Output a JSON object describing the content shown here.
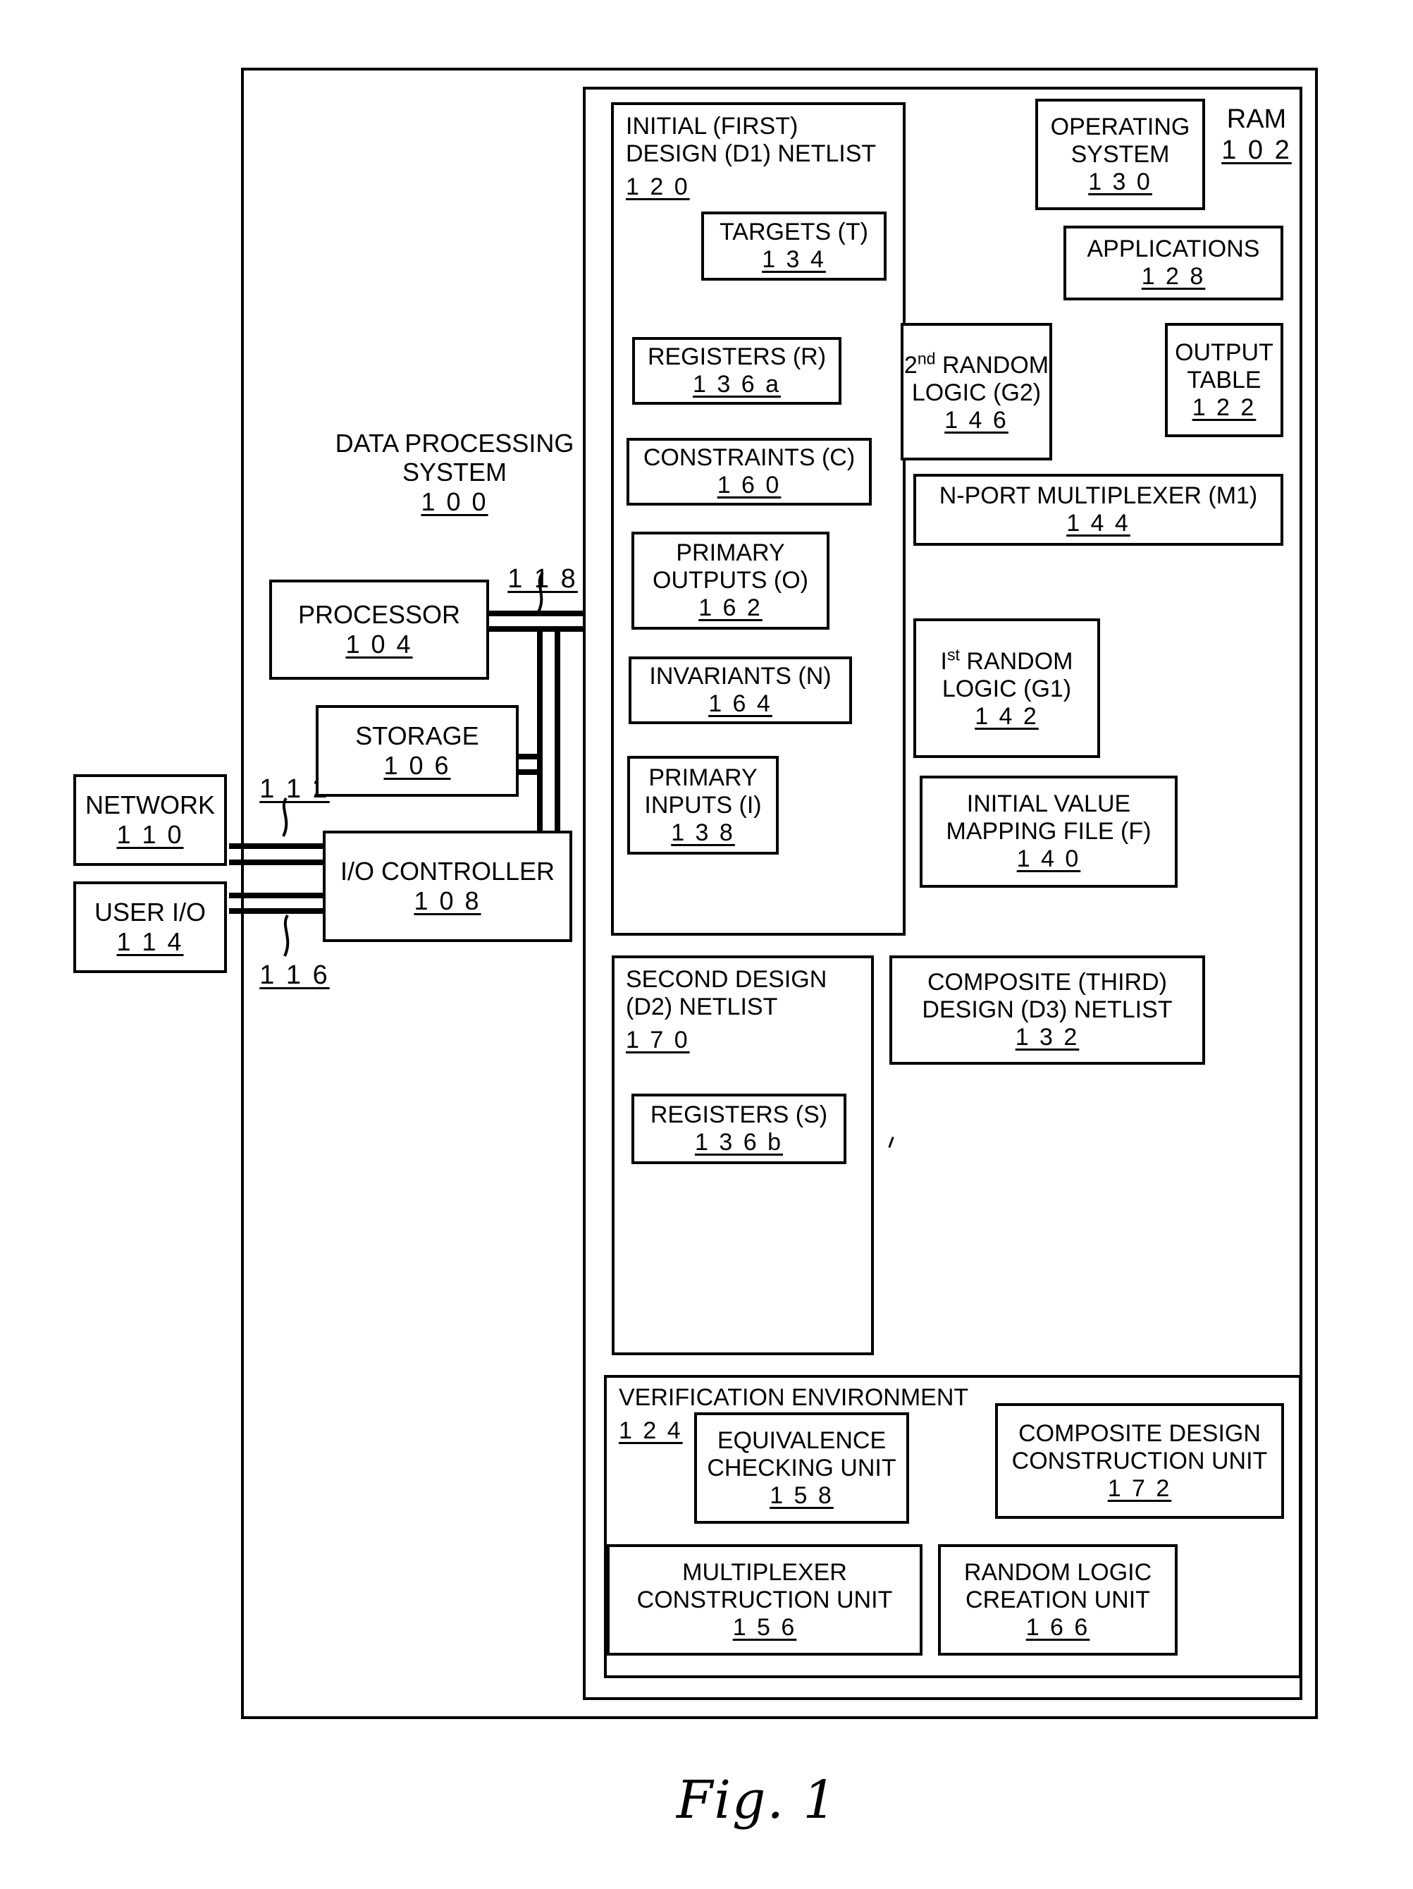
{
  "figure": {
    "caption": "Fig.  1"
  },
  "system": {
    "title_line1": "DATA PROCESSING",
    "title_line2": "SYSTEM",
    "ref": "1 0 0"
  },
  "bus": {
    "ref_118": "1 1 8",
    "ref_112": "1 1 2",
    "ref_116": "1 1 6"
  },
  "hardware": [
    {
      "name": "processor",
      "label": "PROCESSOR",
      "ref": "1 0 4"
    },
    {
      "name": "storage",
      "label": "STORAGE",
      "ref": "1 0 6"
    },
    {
      "name": "io-controller",
      "label": "I/O CONTROLLER",
      "ref": "1 0 8"
    },
    {
      "name": "network",
      "label": "NETWORK",
      "ref": "1 1 0"
    },
    {
      "name": "user-io",
      "label": "USER I/O",
      "ref": "1 1 4"
    }
  ],
  "ram": {
    "label": "RAM",
    "ref": "1 0 2"
  },
  "d1": {
    "label_line1": "INITIAL (FIRST)",
    "label_line2": "DESIGN (D1) NETLIST",
    "ref": "1 2 0",
    "children": [
      {
        "name": "targets",
        "line1": "TARGETS (T)",
        "line2": "",
        "ref": "1 3 4"
      },
      {
        "name": "registers-r",
        "line1": "REGISTERS (R)",
        "line2": "",
        "ref": "1 3 6 a"
      },
      {
        "name": "constraints",
        "line1": "CONSTRAINTS (C)",
        "line2": "",
        "ref": "1 6 0"
      },
      {
        "name": "primary-outputs",
        "line1": "PRIMARY",
        "line2": "OUTPUTS (O)",
        "ref": "1 6 2"
      },
      {
        "name": "invariants",
        "line1": "INVARIANTS (N)",
        "line2": "",
        "ref": "1 6 4"
      },
      {
        "name": "primary-inputs",
        "line1": "PRIMARY",
        "line2": "INPUTS (I)",
        "ref": "1 3 8"
      }
    ]
  },
  "ram_items": [
    {
      "name": "operating-system",
      "line1": "OPERATING",
      "line2": "SYSTEM",
      "ref": "1 3 0"
    },
    {
      "name": "applications",
      "line1": "APPLICATIONS",
      "line2": "",
      "ref": "1 2 8"
    },
    {
      "name": "second-random-logic",
      "line1": "2<sup>nd</sup> RANDOM",
      "line2": "LOGIC (G2)",
      "ref": "1 4 6"
    },
    {
      "name": "output-table",
      "line1": "OUTPUT",
      "line2": "TABLE",
      "ref": "1 2 2"
    },
    {
      "name": "n-port-multiplexer",
      "line1": "N-PORT MULTIPLEXER (M1)",
      "line2": "",
      "ref": "1 4 4"
    },
    {
      "name": "first-random-logic",
      "line1": "I<sup>st</sup>  RANDOM",
      "line2": "LOGIC (G1)",
      "ref": "1 4 2"
    },
    {
      "name": "initial-value-mapping-file",
      "line1": "INITIAL VALUE",
      "line2": "MAPPING FILE (F)",
      "ref": "1 4 0"
    }
  ],
  "d2": {
    "label_line1": "SECOND DESIGN",
    "label_line2": "(D2) NETLIST",
    "ref": "1 7 0",
    "children": [
      {
        "name": "registers-s",
        "line1": "REGISTERS (S)",
        "line2": "",
        "ref": "1 3 6 b"
      }
    ]
  },
  "d3": {
    "label_line1": "COMPOSITE (THIRD)",
    "label_line2": "DESIGN (D3) NETLIST",
    "ref": "1 3 2"
  },
  "verification": {
    "label": "VERIFICATION ENVIRONMENT",
    "ref": "1 2 4",
    "children": [
      {
        "name": "equivalence-checking-unit",
        "line1": "EQUIVALENCE",
        "line2": "CHECKING UNIT",
        "ref": "1 5 8"
      },
      {
        "name": "composite-design-construction-unit",
        "line1": "COMPOSITE DESIGN",
        "line2": "CONSTRUCTION UNIT",
        "ref": "1 7 2"
      },
      {
        "name": "multiplexer-construction-unit",
        "line1": "MULTIPLEXER",
        "line2": "CONSTRUCTION UNIT",
        "ref": "1 5 6"
      },
      {
        "name": "random-logic-creation-unit",
        "line1": "RANDOM LOGIC",
        "line2": "CREATION UNIT",
        "ref": "1 6 6"
      }
    ]
  },
  "colors": {
    "ink": "#000000",
    "paper": "#ffffff"
  }
}
